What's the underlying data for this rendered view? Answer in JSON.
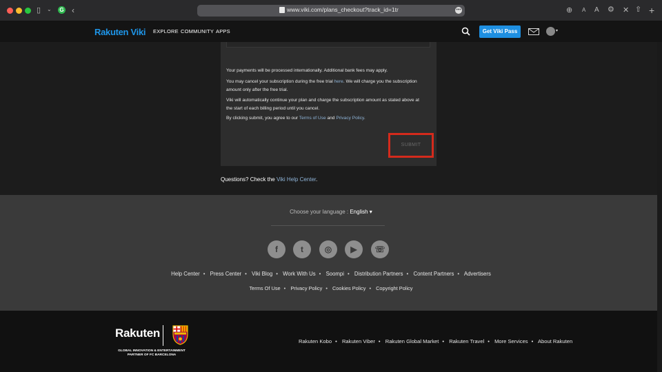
{
  "browser": {
    "url": "www.viki.com/plans_checkout?track_id=1tr"
  },
  "header": {
    "logo": "Rakuten Viki",
    "nav": [
      "EXPLORE",
      "COMMUNITY",
      "APPS"
    ],
    "cta": "Get Viki Pass"
  },
  "checkout": {
    "para1": "Your payments will be processed internationally. Additional bank fees may apply.",
    "para2_a": "You may cancel your subscription during the free trial ",
    "para2_link": "here",
    "para2_b": ". We will charge you the subscription",
    "para2_c": "amount only after the free trial.",
    "para3_a": "Viki will automatically continue your plan and charge the subscription amount as stated above at",
    "para3_b": "the start of each billing period until you cancel.",
    "para4_a": "By clicking submit, you agree to our ",
    "para4_link1": "Terms of Use",
    "para4_mid": " and ",
    "para4_link2": "Privacy Policy",
    "para4_end": ".",
    "submit": "SUBMIT",
    "questions_a": "Questions? Check the ",
    "questions_link": "Viki Help Center",
    "questions_end": "."
  },
  "footer": {
    "language_label": "Choose your language :",
    "language_value": "English ▾",
    "social": [
      "f",
      "t",
      "◎",
      "▶",
      "☏"
    ],
    "links_row1": [
      "Help Center",
      "Press Center",
      "Viki Blog",
      "Work With Us",
      "Soompi",
      "Distribution Partners",
      "Content Partners",
      "Advertisers"
    ],
    "links_row2": [
      "Terms Of Use",
      "Privacy Policy",
      "Cookies Policy",
      "Copyright Policy"
    ]
  },
  "bottom": {
    "brand": "Rakuten",
    "partner_line1": "GLOBAL INNOVATION & ENTERTAINMENT",
    "partner_line2": "PARTNER OF FC BARCELONA",
    "links": [
      "Rakuten Kobo",
      "Rakuten Viber",
      "Rakuten Global Market",
      "Rakuten Travel",
      "More Services",
      "About Rakuten"
    ]
  }
}
